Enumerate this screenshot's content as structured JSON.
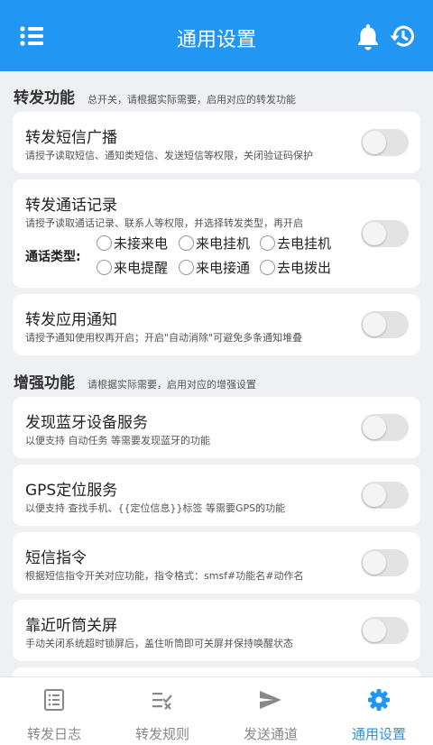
{
  "appbar": {
    "title": "通用设置",
    "icons": {
      "menu": "menu-icon",
      "notification": "bell-icon",
      "history": "history-icon"
    }
  },
  "sections": [
    {
      "heading": "转发功能",
      "subheading": "总开关，请根据实际需要，启用对应的转发功能"
    },
    {
      "heading": "增强功能",
      "subheading": "请根据实际需要，启用对应的增强设置"
    }
  ],
  "forward": {
    "sms": {
      "title": "转发短信广播",
      "desc": "请授予读取短信、通知类短信、发送短信等权限，关闭验证码保护",
      "enabled": false
    },
    "calls": {
      "title": "转发通话记录",
      "desc": "请授予读取通话记录、联系人等权限，并选择转发类型，再开启",
      "call_type_label": "通话类型:",
      "options": [
        "未接来电",
        "来电挂机",
        "去电挂机",
        "来电提醒",
        "来电接通",
        "去电拨出"
      ],
      "enabled": false
    },
    "app_notify": {
      "title": "转发应用通知",
      "desc": "请授予通知使用权再开启；开启\"自动消除\"可避免多条通知堆叠",
      "enabled": false
    }
  },
  "enhance": {
    "bluetooth": {
      "title": "发现蓝牙设备服务",
      "desc": "以便支持 自动任务 等需要发现蓝牙的功能",
      "enabled": false
    },
    "gps": {
      "title": "GPS定位服务",
      "desc": "以便支持 查找手机、{{定位信息}}标签 等需要GPS的功能",
      "enabled": false
    },
    "sms_command": {
      "title": "短信指令",
      "desc": "根据短信指令开关对应功能，指令格式：smsf#功能名#动作名",
      "enabled": false
    },
    "proximity": {
      "title": "靠近听筒关屏",
      "desc": "手动关闭系统超时锁屏后，盖住听筒即可关屏并保持唤醒状态",
      "enabled": false
    }
  },
  "navbar": {
    "tabs": [
      {
        "label": "转发日志",
        "icon": "log-icon"
      },
      {
        "label": "转发规则",
        "icon": "rules-icon"
      },
      {
        "label": "发送通道",
        "icon": "send-icon"
      },
      {
        "label": "通用设置",
        "icon": "gear-icon"
      }
    ],
    "active_tab": "通用设置"
  },
  "colors": {
    "primary": "#2196f3",
    "background": "#eef0f3",
    "toggle_off": "#e3e3e3"
  }
}
